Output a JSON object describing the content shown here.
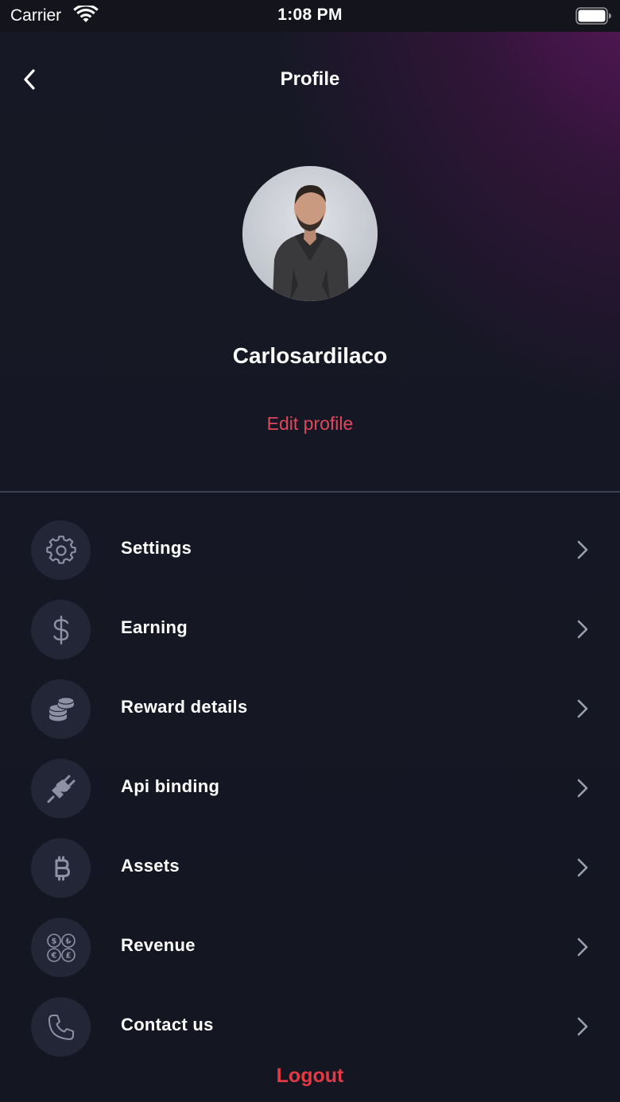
{
  "status_bar": {
    "carrier": "Carrier",
    "time": "1:08 PM",
    "icons": [
      "wifi-icon",
      "battery-icon"
    ]
  },
  "header": {
    "title": "Profile",
    "back_icon": "chevron-left-icon"
  },
  "profile": {
    "username": "Carlosardilaco",
    "edit_label": "Edit profile"
  },
  "menu": {
    "items": [
      {
        "label": "Settings",
        "icon": "gear-icon"
      },
      {
        "label": "Earning",
        "icon": "dollar-icon"
      },
      {
        "label": "Reward details",
        "icon": "coins-icon"
      },
      {
        "label": "Api binding",
        "icon": "plug-icon"
      },
      {
        "label": "Assets",
        "icon": "bitcoin-icon"
      },
      {
        "label": "Revenue",
        "icon": "currencies-icon"
      },
      {
        "label": "Contact us",
        "icon": "phone-icon"
      }
    ]
  },
  "footer": {
    "logout_label": "Logout"
  },
  "colors": {
    "background": "#141622",
    "accent_red": "#e0475a",
    "logout_red": "#e43a44",
    "icon_circle": "#222636",
    "icon_gray": "#8c92a4",
    "gradient_purple": "#681666"
  }
}
